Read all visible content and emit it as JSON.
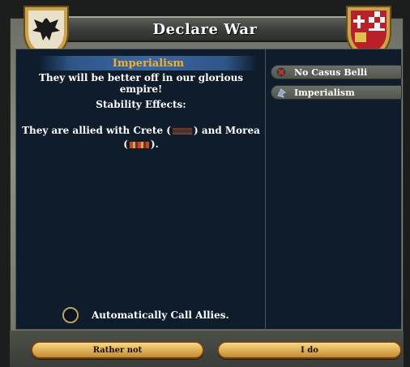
{
  "window": {
    "title": "Declare War"
  },
  "reason": {
    "heading": "Imperialism",
    "description": "They will be better off in our glorious empire!",
    "stability_label": "Stability Effects:",
    "alliance_prefix": "They are allied with Crete (",
    "alliance_mid": ") and Morea",
    "alliance_open": "(",
    "alliance_suffix": ")."
  },
  "casus_belli": [
    {
      "label": "No Casus Belli",
      "icon": "x-icon"
    },
    {
      "label": "Imperialism",
      "icon": "imperialism-icon"
    }
  ],
  "options": {
    "call_allies_label": "Automatically Call Allies."
  },
  "buttons": {
    "cancel_label": "Rather not",
    "confirm_label": "I do"
  },
  "colors": {
    "panel": "#0e1c2c",
    "heading": "#f0b030",
    "button_gold": "#e2b55a"
  }
}
